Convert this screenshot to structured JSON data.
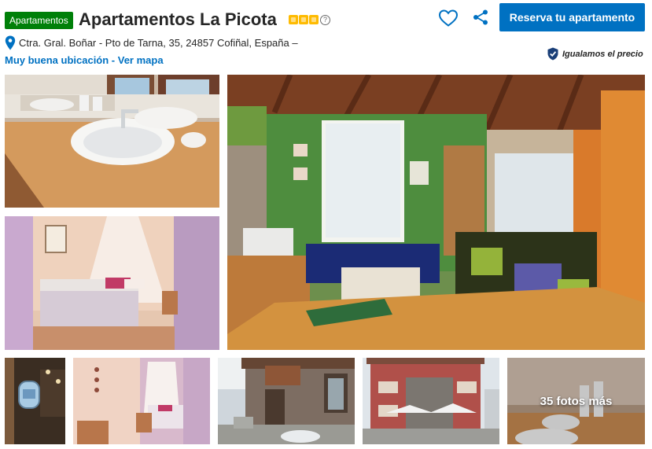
{
  "property": {
    "type_badge": "Apartamentos",
    "title": "Apartamentos La Picota",
    "stars": 3,
    "info_symbol": "?",
    "address": "Ctra. Gral. Boñar - Pto de Tarna, 35, 24857 Cofiñal, España –",
    "location_rating": "Muy buena ubicación",
    "separator": " - ",
    "map_link": "Ver mapa",
    "price_match": "Igualamos el precio"
  },
  "actions": {
    "reserve_label": "Reserva tu apartamento"
  },
  "gallery": {
    "more_label": "35 fotos más"
  },
  "colors": {
    "brand_blue": "#0071c2",
    "badge_green": "#008009",
    "star_yellow": "#febb02"
  },
  "icons": [
    "heart-icon",
    "share-icon",
    "map-pin-icon",
    "price-match-icon",
    "info-icon"
  ]
}
